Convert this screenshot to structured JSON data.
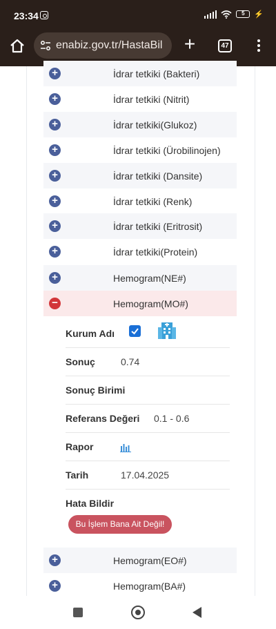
{
  "status_bar": {
    "time": "23:34",
    "battery": "5",
    "icons": [
      "instagram-icon",
      "signal-icon",
      "wifi-icon",
      "battery-icon",
      "charging-icon"
    ]
  },
  "browser": {
    "url": "enabiz.gov.tr/HastaBil",
    "tab_count": "47",
    "icons": [
      "home-icon",
      "site-settings-icon",
      "new-tab-icon",
      "tabs-icon",
      "menu-icon"
    ]
  },
  "test_list": {
    "items": [
      {
        "label": "İdrar tetkiki (Bakteri)",
        "state": "+"
      },
      {
        "label": "İdrar tetkiki (Nitrit)",
        "state": "+"
      },
      {
        "label": "İdrar tetkiki(Glukoz)",
        "state": "+"
      },
      {
        "label": "İdrar tetkiki (Ürobilinojen)",
        "state": "+"
      },
      {
        "label": "İdrar tetkiki (Dansite)",
        "state": "+"
      },
      {
        "label": "İdrar tetkiki (Renk)",
        "state": "+"
      },
      {
        "label": "İdrar tetkiki (Eritrosit)",
        "state": "+"
      },
      {
        "label": "İdrar tetkiki(Protein)",
        "state": "+"
      },
      {
        "label": "Hemogram(NE#)",
        "state": "+"
      },
      {
        "label": "Hemogram(MO#)",
        "state": "−"
      },
      {
        "label": "Hemogram(EO#)",
        "state": "+"
      },
      {
        "label": "Hemogram(BA#)",
        "state": "+"
      }
    ]
  },
  "detail": {
    "institution_label": "Kurum Adı",
    "result_label": "Sonuç",
    "result_value": "0.74",
    "unit_label": "Sonuç Birimi",
    "unit_value": "",
    "reference_label": "Referans Değeri",
    "reference_value": "0.1 - 0.6",
    "report_label": "Rapor",
    "date_label": "Tarih",
    "date_value": "17.04.2025",
    "report_error_label": "Hata Bildir",
    "report_error_button": "Bu İşlem Bana Ait Değil!"
  },
  "colors": {
    "plus_button": "#4a5f9a",
    "minus_button": "#d2363a",
    "active_row": "#fbe9ea",
    "error_button": "#c9535f",
    "checkbox": "#1a6fd6"
  }
}
